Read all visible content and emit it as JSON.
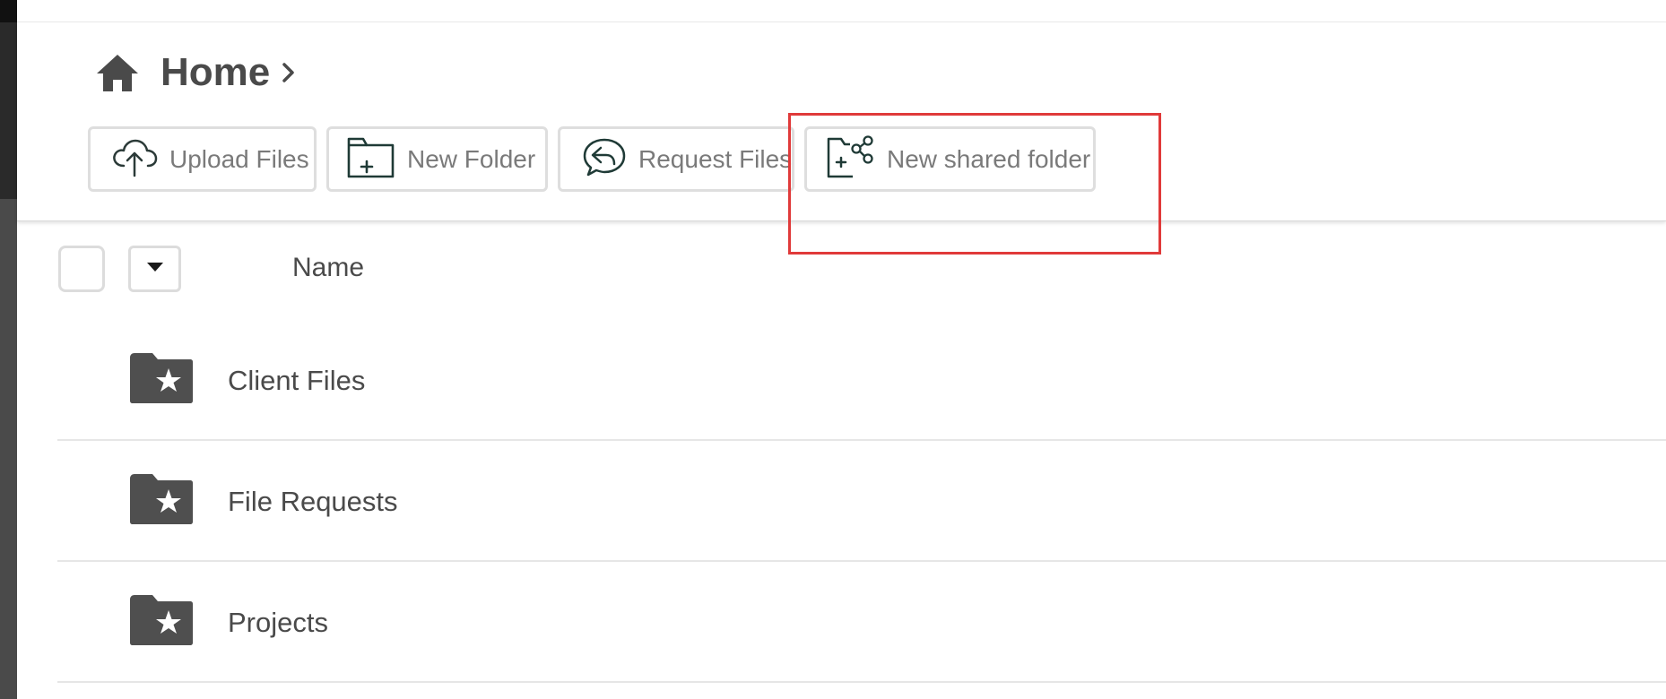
{
  "breadcrumb": {
    "title": "Home",
    "home_icon": "home-icon",
    "separator_icon": "chevron-right-icon"
  },
  "toolbar": {
    "buttons": [
      {
        "label": "Upload Files",
        "icon": "cloud-upload-icon"
      },
      {
        "label": "New Folder",
        "icon": "folder-plus-icon"
      },
      {
        "label": "Request Files",
        "icon": "request-reply-icon"
      },
      {
        "label": "New shared folder",
        "icon": "shared-folder-plus-icon"
      }
    ]
  },
  "list": {
    "column_name": "Name",
    "rows": [
      {
        "name": "Client Files",
        "icon": "starred-folder-icon"
      },
      {
        "name": "File Requests",
        "icon": "starred-folder-icon"
      },
      {
        "name": "Projects",
        "icon": "starred-folder-icon"
      }
    ]
  },
  "colors": {
    "text": "#4a4a4a",
    "button_text": "#7a7a7a",
    "icon_dark": "#1f3a36",
    "highlight": "#e03a3a",
    "border": "#dedede"
  }
}
